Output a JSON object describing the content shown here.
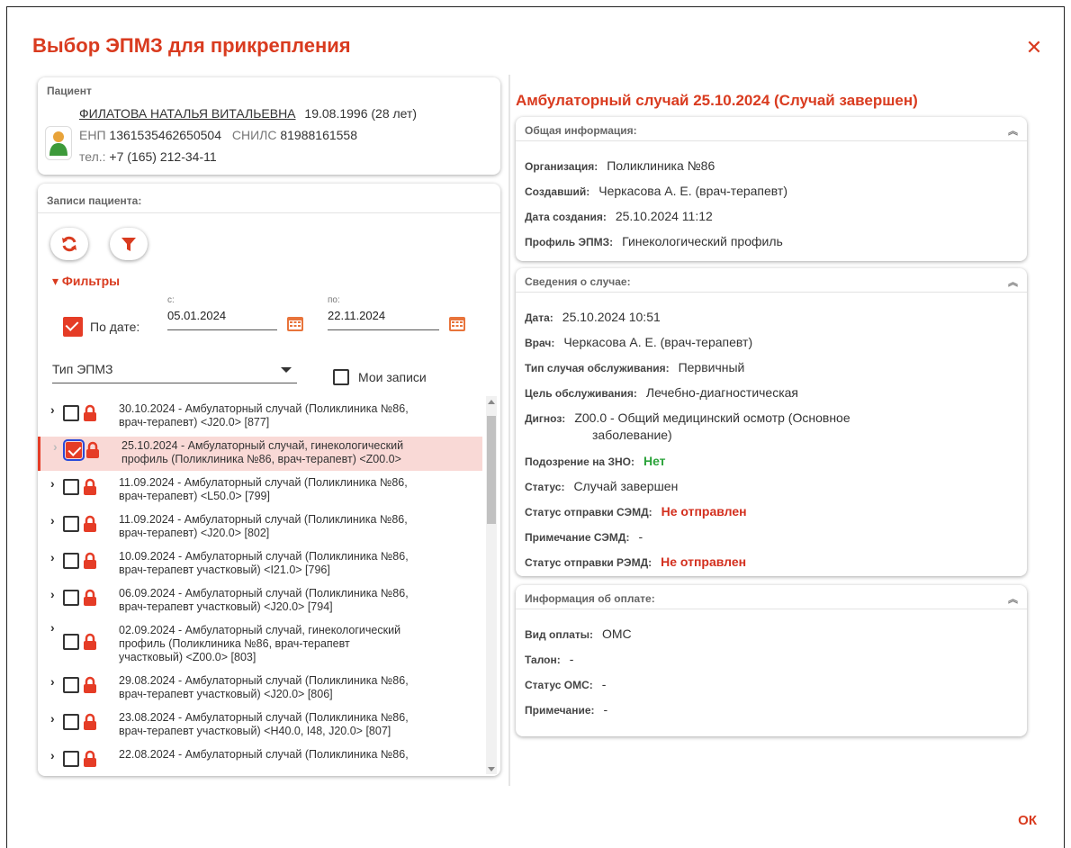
{
  "dialog": {
    "title": "Выбор ЭПМЗ для прикрепления",
    "ok_label": "ОК"
  },
  "patient": {
    "section_title": "Пациент",
    "name": "ФИЛАТОВА НАТАЛЬЯ ВИТАЛЬЕВНА",
    "birth": "19.08.1996 (28 лет)",
    "enp_label": "ЕНП",
    "enp": "1361535462650504",
    "snils_label": "СНИЛС",
    "snils": "81988161558",
    "phone_label": "тел.:",
    "phone": "+7 (165) 212-34-11"
  },
  "records": {
    "section_title": "Записи пациента:",
    "filters_label": "▾ Фильтры",
    "by_date_label": "По дате:",
    "from_label": "с:",
    "from_value": "05.01.2024",
    "to_label": "по:",
    "to_value": "22.11.2024",
    "type_placeholder": "Тип ЭПМЗ",
    "my_records_label": "Мои записи",
    "items": [
      {
        "l1": "30.10.2024 - Амбулаторный случай (Поликлиника №86,",
        "l2": "врач-терапевт) <J20.0>  [877]",
        "l3": "",
        "selected": false
      },
      {
        "l1": "25.10.2024 - Амбулаторный случай, гинекологический",
        "l2": "профиль (Поликлиника №86, врач-терапевт) <Z00.0>",
        "l3": "",
        "selected": true
      },
      {
        "l1": "11.09.2024 - Амбулаторный случай (Поликлиника №86,",
        "l2": "врач-терапевт) <L50.0>  [799]",
        "l3": "",
        "selected": false
      },
      {
        "l1": "11.09.2024 - Амбулаторный случай (Поликлиника №86,",
        "l2": "врач-терапевт) <J20.0>  [802]",
        "l3": "",
        "selected": false
      },
      {
        "l1": "10.09.2024 - Амбулаторный случай (Поликлиника №86,",
        "l2": "врач-терапевт участковый) <I21.0>  [796]",
        "l3": "",
        "selected": false
      },
      {
        "l1": "06.09.2024 - Амбулаторный случай (Поликлиника №86,",
        "l2": "врач-терапевт участковый) <J20.0>  [794]",
        "l3": "",
        "selected": false
      },
      {
        "l1": "02.09.2024 - Амбулаторный случай, гинекологический",
        "l2": "профиль (Поликлиника №86, врач-терапевт",
        "l3": "участковый) <Z00.0>  [803]",
        "selected": false
      },
      {
        "l1": "29.08.2024 - Амбулаторный случай (Поликлиника №86,",
        "l2": "врач-терапевт участковый) <J20.0>  [806]",
        "l3": "",
        "selected": false
      },
      {
        "l1": "23.08.2024 - Амбулаторный случай (Поликлиника №86,",
        "l2": "врач-терапевт участковый) <H40.0, I48, J20.0>  [807]",
        "l3": "",
        "selected": false
      },
      {
        "l1": "22.08.2024 - Амбулаторный случай (Поликлиника №86,",
        "l2": "",
        "l3": "",
        "selected": false
      }
    ]
  },
  "case": {
    "title": "Амбулаторный случай 25.10.2024 (Случай завершен)",
    "general": {
      "title": "Общая информация:",
      "org_k": "Организация:",
      "org_v": "Поликлиника №86",
      "creator_k": "Создавший:",
      "creator_v": "Черкасова А. Е. (врач-терапевт)",
      "created_k": "Дата создания:",
      "created_v": "25.10.2024 11:12",
      "profile_k": "Профиль ЭПМЗ:",
      "profile_v": "Гинекологический профиль"
    },
    "details": {
      "title": "Сведения о случае:",
      "date_k": "Дата:",
      "date_v": "25.10.2024 10:51",
      "doctor_k": "Врач:",
      "doctor_v": "Черкасова А. Е. (врач-терапевт)",
      "type_k": "Тип случая обслуживания:",
      "type_v": "Первичный",
      "goal_k": "Цель обслуживания:",
      "goal_v": "Лечебно-диагностическая",
      "diag_k": "Дигноз:",
      "diag_v1": "Z00.0 - Общий медицинский осмотр (Основное",
      "diag_v2": "заболевание)",
      "zno_k": "Подозрение на ЗНО:",
      "zno_v": "Нет",
      "status_k": "Статус:",
      "status_v": "Случай завершен",
      "semd_k": "Статус отправки СЭМД:",
      "semd_v": "Не отправлен",
      "semd_note_k": "Примечание СЭМД:",
      "semd_note_v": "-",
      "remd_k": "Статус отправки РЭМД:",
      "remd_v": "Не отправлен"
    },
    "payment": {
      "title": "Информация об оплате:",
      "kind_k": "Вид оплаты:",
      "kind_v": "ОМС",
      "ticket_k": "Талон:",
      "ticket_v": "-",
      "oms_k": "Статус ОМС:",
      "oms_v": "-",
      "note_k": "Примечание:",
      "note_v": "-"
    }
  },
  "colors": {
    "accent": "#d93b1f",
    "danger": "#d32f1e",
    "ok": "#2ba33a",
    "selection": "#f9d9d6"
  }
}
